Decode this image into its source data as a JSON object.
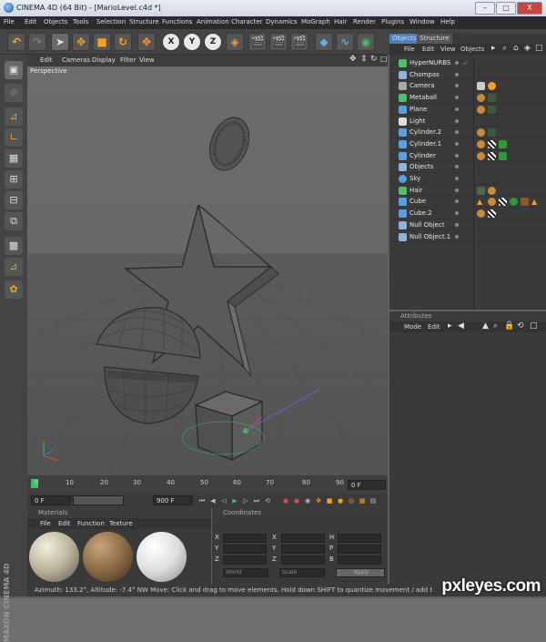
{
  "window": {
    "title": "CINEMA 4D (64 Bit) - [MarioLevel.c4d *]",
    "buttons": [
      "–",
      "□",
      "X"
    ]
  },
  "menubar": [
    "File",
    "Edit",
    "Objects",
    "Tools",
    "Selection",
    "Structure",
    "Functions",
    "Animation",
    "Character",
    "Dynamics",
    "MoGraph",
    "Hair",
    "Render",
    "Plugins",
    "Window",
    "Help"
  ],
  "toolbar": {
    "axis_x": "X",
    "axis_y": "Y",
    "axis_z": "Z"
  },
  "viewport": {
    "menu": [
      "Edit",
      "Cameras",
      "Display",
      "Filter",
      "View"
    ],
    "label": "Perspective"
  },
  "timeline": {
    "ticks": [
      "0",
      "10",
      "20",
      "30",
      "40",
      "50",
      "60",
      "70",
      "80",
      "90"
    ],
    "current_frame": "0 F",
    "start_frame": "0 F",
    "end_frame": "900 F"
  },
  "materials": {
    "header": "Materials",
    "menu": [
      "File",
      "Edit",
      "Function",
      "Texture"
    ]
  },
  "coordinates": {
    "header": "Coordinates",
    "rows": [
      {
        "a": "X",
        "b": "X",
        "c": "H"
      },
      {
        "a": "Y",
        "b": "Y",
        "c": "P"
      },
      {
        "a": "Z",
        "b": "Z",
        "c": "B"
      }
    ],
    "mode_world": "World",
    "mode_scale": "Scale",
    "apply": "Apply"
  },
  "objects_panel": {
    "tabs": [
      "Objects",
      "Structure"
    ],
    "menu": [
      "File",
      "Edit",
      "View",
      "Objects"
    ],
    "items": [
      {
        "name": "HyperNURBS",
        "color": "#4fbf6a"
      },
      {
        "name": "Chompas",
        "color": "#8fb3d9"
      },
      {
        "name": "Camera",
        "color": "#aaaaaa"
      },
      {
        "name": "Metaball",
        "color": "#4fbf6a"
      },
      {
        "name": "Plane",
        "color": "#5aa0e0"
      },
      {
        "name": "Light",
        "color": "#dddddd"
      },
      {
        "name": "Cylinder.2",
        "color": "#5aa0e0"
      },
      {
        "name": "Cylinder.1",
        "color": "#5aa0e0"
      },
      {
        "name": "Cylinder",
        "color": "#5aa0e0"
      },
      {
        "name": "Objects",
        "color": "#8fb3d9"
      },
      {
        "name": "Sky",
        "color": "#5aa0e0"
      },
      {
        "name": "Hair",
        "color": "#4fbf6a"
      },
      {
        "name": "Cube",
        "color": "#5aa0e0"
      },
      {
        "name": "Cube.2",
        "color": "#5aa0e0"
      },
      {
        "name": "Null Object",
        "color": "#8fb3d9"
      },
      {
        "name": "Null Object.1",
        "color": "#8fb3d9"
      }
    ]
  },
  "attributes_panel": {
    "header": "Attributes",
    "menu": [
      "Mode",
      "Edit"
    ]
  },
  "statusbar": "Azimuth: 133.2°, Altitude: -7.4°  NW   Move: Click and drag to move elements. Hold down SHIFT to quantize movement / add t",
  "maxon_logo": "MAXON CINEMA 4D",
  "watermark": "pxleyes.com"
}
